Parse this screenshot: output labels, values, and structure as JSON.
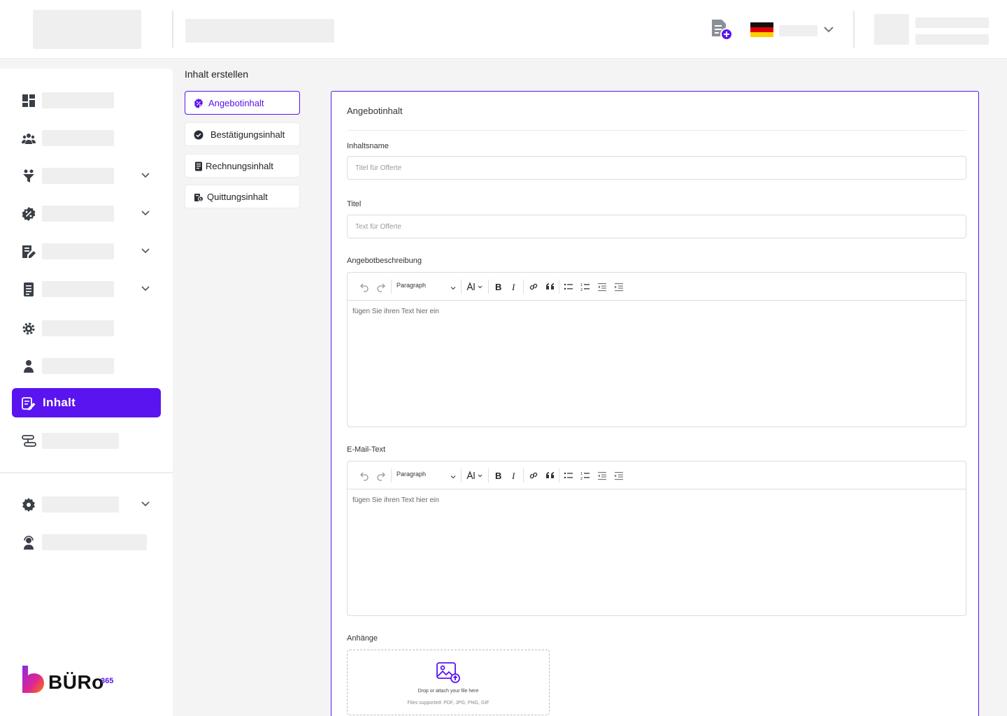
{
  "sidebar": {
    "active_item": {
      "label": "Inhalt",
      "icon": "edit-content-icon"
    },
    "brand": {
      "wordmark": "BÜRo",
      "superscript": "365"
    }
  },
  "page": {
    "title": "Inhalt erstellen"
  },
  "content_tabs": [
    {
      "label": "Angebotinhalt",
      "icon": "offer-badge-icon",
      "active": true
    },
    {
      "label": "Bestätigungsinhalt",
      "icon": "check-circle-icon",
      "active": false
    },
    {
      "label": "Rechnungsinhalt",
      "icon": "invoice-icon",
      "active": false
    },
    {
      "label": "Quittungsinhalt",
      "icon": "receipt-icon",
      "active": false
    }
  ],
  "form": {
    "section_title": "Angebotinhalt",
    "content_name": {
      "label": "Inhaltsname",
      "placeholder": "Titel für Offerte",
      "value": ""
    },
    "title": {
      "label": "Titel",
      "placeholder": "Text für Offerte",
      "value": ""
    },
    "offer_description": {
      "label": "Angebotbeschreibung",
      "paragraph_style": "Paragraph",
      "placeholder": "fügen Sie ihren Text hier ein"
    },
    "email_text": {
      "label": "E-Mail-Text",
      "paragraph_style": "Paragraph",
      "placeholder": "fügen Sie ihren Text hier ein"
    },
    "attachments": {
      "label": "Anhänge",
      "drop_text": "Drop or attach your file here",
      "supported_text": "Files supported: PDF, JPG, PNG, GIF"
    }
  },
  "colors": {
    "accent": "#5a14f0",
    "border": "#dcdcdc",
    "placeholder_block": "#efefef"
  }
}
